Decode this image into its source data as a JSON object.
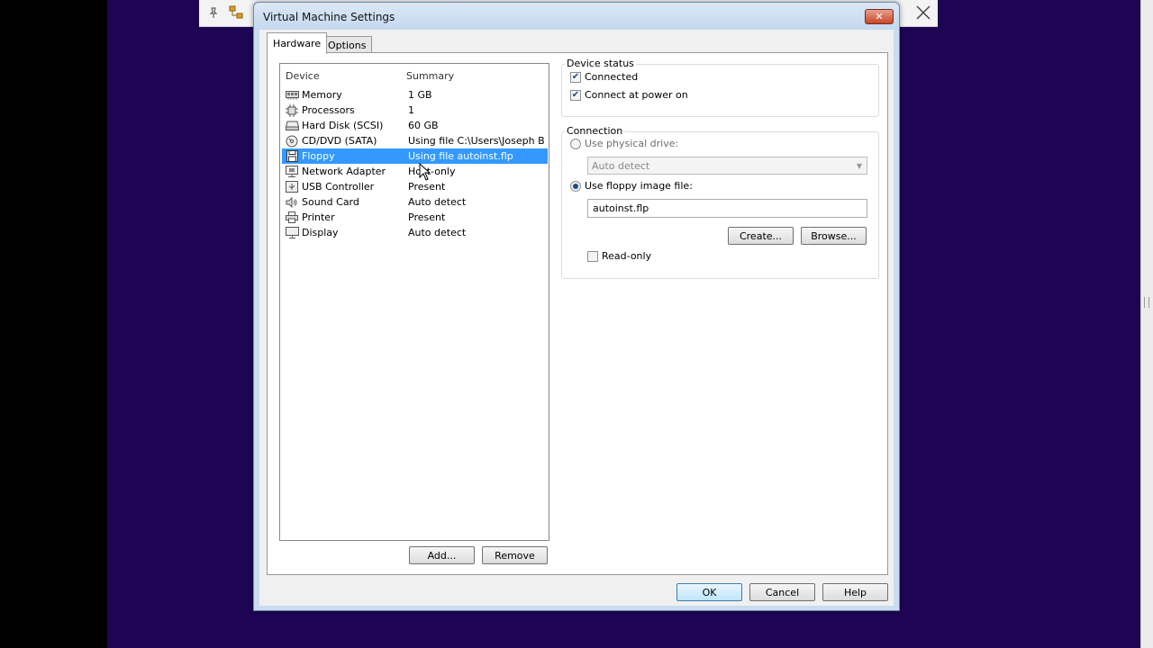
{
  "window": {
    "title": "Virtual Machine Settings",
    "close_glyph": "✕"
  },
  "tabs": [
    {
      "label": "Hardware",
      "active": true
    },
    {
      "label": "Options",
      "active": false
    }
  ],
  "device_list": {
    "header_device": "Device",
    "header_summary": "Summary",
    "selected": "Floppy",
    "rows": [
      {
        "name": "Memory",
        "summary": "1 GB",
        "icon": "memory-icon"
      },
      {
        "name": "Processors",
        "summary": "1",
        "icon": "processor-icon"
      },
      {
        "name": "Hard Disk (SCSI)",
        "summary": "60 GB",
        "icon": "hard-disk-icon"
      },
      {
        "name": "CD/DVD (SATA)",
        "summary": "Using file C:\\Users\\Joseph Bi...",
        "icon": "cd-dvd-icon"
      },
      {
        "name": "Floppy",
        "summary": "Using file autoinst.flp",
        "icon": "floppy-icon"
      },
      {
        "name": "Network Adapter",
        "summary": "Host-only",
        "icon": "network-adapter-icon"
      },
      {
        "name": "USB Controller",
        "summary": "Present",
        "icon": "usb-icon"
      },
      {
        "name": "Sound Card",
        "summary": "Auto detect",
        "icon": "speaker-icon"
      },
      {
        "name": "Printer",
        "summary": "Present",
        "icon": "printer-icon"
      },
      {
        "name": "Display",
        "summary": "Auto detect",
        "icon": "display-icon"
      }
    ]
  },
  "list_buttons": {
    "add": "Add...",
    "remove": "Remove"
  },
  "device_status": {
    "label": "Device status",
    "connected": {
      "label": "Connected",
      "checked": true
    },
    "connect_at_power_on": {
      "label": "Connect at power on",
      "checked": true
    }
  },
  "connection": {
    "label": "Connection",
    "use_physical_drive": {
      "label": "Use physical drive:",
      "selected": false
    },
    "physical_drive_select": "Auto detect",
    "use_floppy_image": {
      "label": "Use floppy image file:",
      "selected": true
    },
    "image_file_value": "autoinst.flp",
    "create_button": "Create...",
    "browse_button": "Browse...",
    "read_only": {
      "label": "Read-only",
      "checked": false
    }
  },
  "footer_buttons": {
    "ok": "OK",
    "cancel": "Cancel",
    "help": "Help"
  },
  "colors": {
    "selection": "#3399ff",
    "desktop": "#1e0554"
  }
}
